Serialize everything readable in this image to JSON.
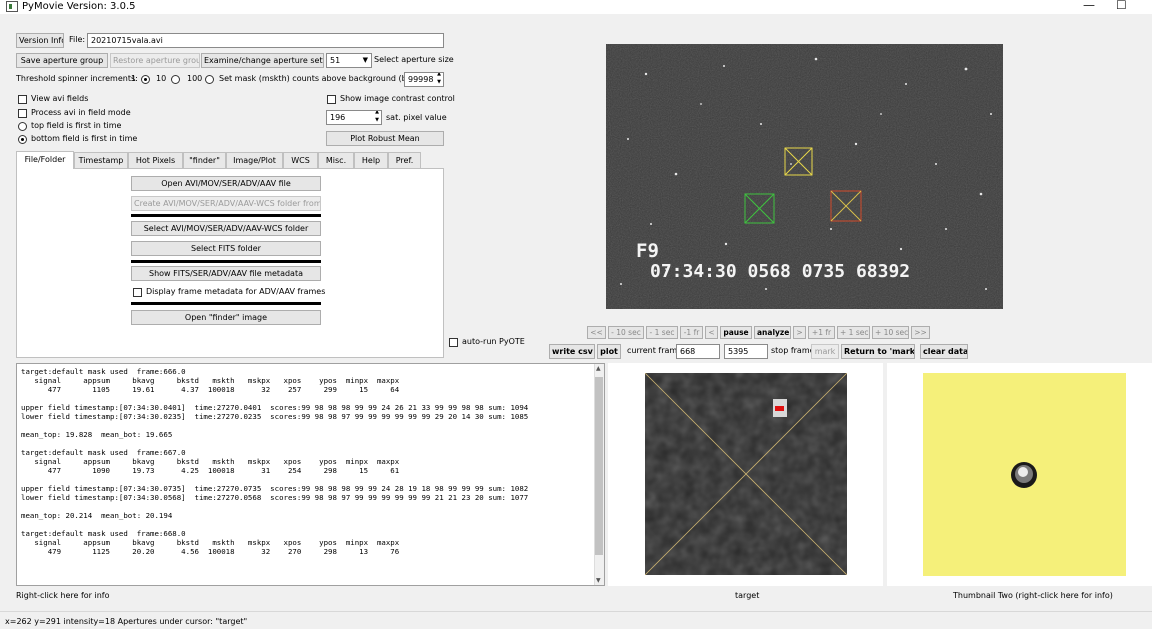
{
  "window": {
    "title": "PyMovie  Version: 3.0.5",
    "minimize": "—",
    "maximize": "☐"
  },
  "top": {
    "version_info": "Version Info",
    "file_label": "File:",
    "file_name": "20210715vala.avi",
    "save_group": "Save aperture group",
    "restore_group": "Restore aperture group",
    "examine_settings": "Examine/change aperture settings",
    "aperture_size": "51",
    "aperture_size_label": "Select aperture size",
    "threshold_label": "Threshold spinner increments:",
    "inc1": "1",
    "inc10": "10",
    "inc100": "100",
    "mask_label": "Set mask (mskth) counts above background (bkavg)",
    "mask_value": "99998"
  },
  "options": {
    "view_avi_fields": "View avi fields",
    "process_field_mode": "Process avi in field mode",
    "top_first": "top field is first in time",
    "bottom_first": "bottom field is first in time",
    "show_contrast": "Show image contrast control",
    "sat_value": "196",
    "sat_label": "sat. pixel value",
    "plot_robust": "Plot Robust Mean"
  },
  "tabs": [
    "File/Folder",
    "Timestamp",
    "Hot Pixels",
    "\"finder\"",
    "Image/Plot",
    "WCS",
    "Misc.",
    "Help",
    "Pref."
  ],
  "file_panel": {
    "open_avi": "Open AVI/MOV/SER/ADV/AAV file",
    "create_wcs": "Create AVI/MOV/SER/ADV/AAV-WCS folder from file",
    "select_wcs": "Select AVI/MOV/SER/ADV/AAV-WCS folder",
    "select_fits": "Select FITS folder",
    "show_metadata": "Show FITS/SER/ADV/AAV file metadata",
    "display_metadata": "Display frame metadata for ADV/AAV frames",
    "open_finder": "Open \"finder\" image"
  },
  "log_lines": [
    "target:default mask used  frame:666.0",
    "   signal     appsum     bkavg     bkstd   mskth   mskpx   xpos    ypos  minpx  maxpx",
    "      477       1105     19.61      4.37  100018      32    257     299     15     64",
    "",
    "upper field timestamp:[07:34:30.0401]  time:27270.0401  scores:99 98 98 98 99 99 24 26 21 33 99 99 98 98 sum: 1094",
    "lower field timestamp:[07:34:30.0235]  time:27270.0235  scores:99 98 98 97 99 99 99 99 99 99 29 20 14 30 sum: 1085",
    "",
    "mean_top: 19.828  mean_bot: 19.665",
    "",
    "target:default mask used  frame:667.0",
    "   signal     appsum     bkavg     bkstd   mskth   mskpx   xpos    ypos  minpx  maxpx",
    "      477       1090     19.73      4.25  100018      31    254     298     15     61",
    "",
    "upper field timestamp:[07:34:30.0735]  time:27270.0735  scores:99 98 98 98 99 99 24 28 19 18 98 99 99 99 sum: 1082",
    "lower field timestamp:[07:34:30.0568]  time:27270.0568  scores:99 98 98 97 99 99 99 99 99 99 21 21 23 20 sum: 1077",
    "",
    "mean_top: 20.214  mean_bot: 20.194",
    "",
    "target:default mask used  frame:668.0",
    "   signal     appsum     bkavg     bkstd   mskth   mskpx   xpos    ypos  minpx  maxpx",
    "      479       1125     20.20      4.56  100018      32    270     298     13     76"
  ],
  "video": {
    "field_label": "F9",
    "timestamp": "07:34:30",
    "counter1": "0568",
    "counter2": "0735",
    "counter3": "68392"
  },
  "nav": {
    "first": "<<",
    "m10": "- 10 sec",
    "m1": "- 1 sec",
    "m1fr": "-1 fr",
    "prev": "<",
    "pause": "pause",
    "analyze": "analyze",
    "next": ">",
    "p1fr": "+1 fr",
    "p1": "+ 1 sec",
    "p10": "+ 10 sec",
    "last": ">>"
  },
  "controls": {
    "auto_run": "auto-run PyOTE",
    "write_csv": "write csv",
    "plot": "plot",
    "current_frame_label": "current frame",
    "current_frame": "668",
    "stop_frame": "5395",
    "stop_frame_label": "stop frame",
    "mark": "mark",
    "return_mark": "Return to 'mark'",
    "clear_data": "clear data"
  },
  "thumbnails": {
    "one_label": "target",
    "two_label": "Thumbnail Two (right-click here for info)"
  },
  "log_footer": "Right-click here for info",
  "status": "x=262 y=291 intensity=18   Apertures under cursor: \"target\"",
  "colors": {
    "accent_yellow": "#f5f07a",
    "aperture_yellow": "#e8d84a",
    "aperture_green": "#3fc23f",
    "aperture_red": "#d24a2a"
  }
}
